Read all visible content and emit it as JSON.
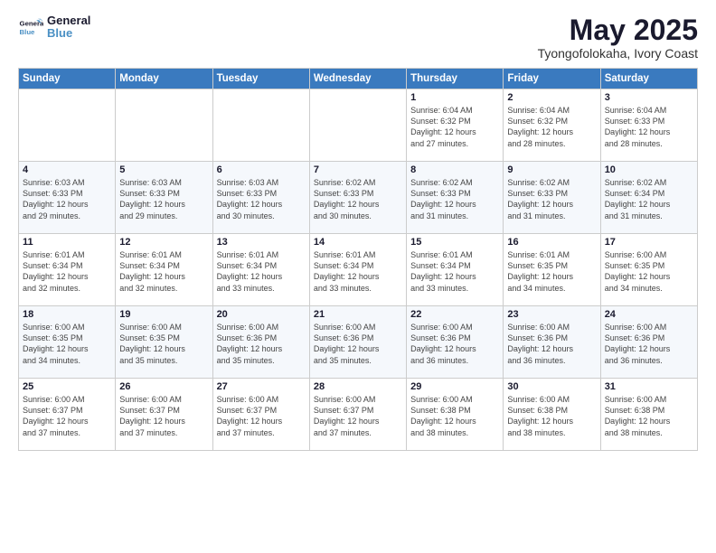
{
  "logo": {
    "line1": "General",
    "line2": "Blue"
  },
  "title": "May 2025",
  "subtitle": "Tyongofolokaha, Ivory Coast",
  "weekdays": [
    "Sunday",
    "Monday",
    "Tuesday",
    "Wednesday",
    "Thursday",
    "Friday",
    "Saturday"
  ],
  "weeks": [
    [
      {
        "day": "",
        "info": ""
      },
      {
        "day": "",
        "info": ""
      },
      {
        "day": "",
        "info": ""
      },
      {
        "day": "",
        "info": ""
      },
      {
        "day": "1",
        "info": "Sunrise: 6:04 AM\nSunset: 6:32 PM\nDaylight: 12 hours\nand 27 minutes."
      },
      {
        "day": "2",
        "info": "Sunrise: 6:04 AM\nSunset: 6:32 PM\nDaylight: 12 hours\nand 28 minutes."
      },
      {
        "day": "3",
        "info": "Sunrise: 6:04 AM\nSunset: 6:33 PM\nDaylight: 12 hours\nand 28 minutes."
      }
    ],
    [
      {
        "day": "4",
        "info": "Sunrise: 6:03 AM\nSunset: 6:33 PM\nDaylight: 12 hours\nand 29 minutes."
      },
      {
        "day": "5",
        "info": "Sunrise: 6:03 AM\nSunset: 6:33 PM\nDaylight: 12 hours\nand 29 minutes."
      },
      {
        "day": "6",
        "info": "Sunrise: 6:03 AM\nSunset: 6:33 PM\nDaylight: 12 hours\nand 30 minutes."
      },
      {
        "day": "7",
        "info": "Sunrise: 6:02 AM\nSunset: 6:33 PM\nDaylight: 12 hours\nand 30 minutes."
      },
      {
        "day": "8",
        "info": "Sunrise: 6:02 AM\nSunset: 6:33 PM\nDaylight: 12 hours\nand 31 minutes."
      },
      {
        "day": "9",
        "info": "Sunrise: 6:02 AM\nSunset: 6:33 PM\nDaylight: 12 hours\nand 31 minutes."
      },
      {
        "day": "10",
        "info": "Sunrise: 6:02 AM\nSunset: 6:34 PM\nDaylight: 12 hours\nand 31 minutes."
      }
    ],
    [
      {
        "day": "11",
        "info": "Sunrise: 6:01 AM\nSunset: 6:34 PM\nDaylight: 12 hours\nand 32 minutes."
      },
      {
        "day": "12",
        "info": "Sunrise: 6:01 AM\nSunset: 6:34 PM\nDaylight: 12 hours\nand 32 minutes."
      },
      {
        "day": "13",
        "info": "Sunrise: 6:01 AM\nSunset: 6:34 PM\nDaylight: 12 hours\nand 33 minutes."
      },
      {
        "day": "14",
        "info": "Sunrise: 6:01 AM\nSunset: 6:34 PM\nDaylight: 12 hours\nand 33 minutes."
      },
      {
        "day": "15",
        "info": "Sunrise: 6:01 AM\nSunset: 6:34 PM\nDaylight: 12 hours\nand 33 minutes."
      },
      {
        "day": "16",
        "info": "Sunrise: 6:01 AM\nSunset: 6:35 PM\nDaylight: 12 hours\nand 34 minutes."
      },
      {
        "day": "17",
        "info": "Sunrise: 6:00 AM\nSunset: 6:35 PM\nDaylight: 12 hours\nand 34 minutes."
      }
    ],
    [
      {
        "day": "18",
        "info": "Sunrise: 6:00 AM\nSunset: 6:35 PM\nDaylight: 12 hours\nand 34 minutes."
      },
      {
        "day": "19",
        "info": "Sunrise: 6:00 AM\nSunset: 6:35 PM\nDaylight: 12 hours\nand 35 minutes."
      },
      {
        "day": "20",
        "info": "Sunrise: 6:00 AM\nSunset: 6:36 PM\nDaylight: 12 hours\nand 35 minutes."
      },
      {
        "day": "21",
        "info": "Sunrise: 6:00 AM\nSunset: 6:36 PM\nDaylight: 12 hours\nand 35 minutes."
      },
      {
        "day": "22",
        "info": "Sunrise: 6:00 AM\nSunset: 6:36 PM\nDaylight: 12 hours\nand 36 minutes."
      },
      {
        "day": "23",
        "info": "Sunrise: 6:00 AM\nSunset: 6:36 PM\nDaylight: 12 hours\nand 36 minutes."
      },
      {
        "day": "24",
        "info": "Sunrise: 6:00 AM\nSunset: 6:36 PM\nDaylight: 12 hours\nand 36 minutes."
      }
    ],
    [
      {
        "day": "25",
        "info": "Sunrise: 6:00 AM\nSunset: 6:37 PM\nDaylight: 12 hours\nand 37 minutes."
      },
      {
        "day": "26",
        "info": "Sunrise: 6:00 AM\nSunset: 6:37 PM\nDaylight: 12 hours\nand 37 minutes."
      },
      {
        "day": "27",
        "info": "Sunrise: 6:00 AM\nSunset: 6:37 PM\nDaylight: 12 hours\nand 37 minutes."
      },
      {
        "day": "28",
        "info": "Sunrise: 6:00 AM\nSunset: 6:37 PM\nDaylight: 12 hours\nand 37 minutes."
      },
      {
        "day": "29",
        "info": "Sunrise: 6:00 AM\nSunset: 6:38 PM\nDaylight: 12 hours\nand 38 minutes."
      },
      {
        "day": "30",
        "info": "Sunrise: 6:00 AM\nSunset: 6:38 PM\nDaylight: 12 hours\nand 38 minutes."
      },
      {
        "day": "31",
        "info": "Sunrise: 6:00 AM\nSunset: 6:38 PM\nDaylight: 12 hours\nand 38 minutes."
      }
    ]
  ]
}
